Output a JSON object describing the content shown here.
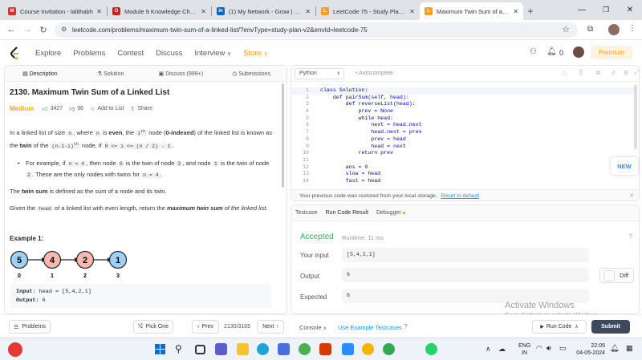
{
  "browser": {
    "tabs": [
      {
        "title": "Course Invitation - lalithabh",
        "icon_color": "#d93025",
        "icon_letter": "M"
      },
      {
        "title": "Module 9 Knowledge Check",
        "icon_color": "#c5221f",
        "icon_letter": "O"
      },
      {
        "title": "(1) My Network - Grow | Lin",
        "icon_color": "#0a66c2",
        "icon_letter": "in"
      },
      {
        "title": "LeetCode 75 - Study Plan - L",
        "icon_color": "#f89f1b",
        "icon_letter": "L"
      },
      {
        "title": "Maximum Twin Sum of a Lin",
        "icon_color": "#f89f1b",
        "icon_letter": "L"
      }
    ],
    "url": "leetcode.com/problems/maximum-twin-sum-of-a-linked-list/?envType=study-plan-v2&envId=leetcode-75"
  },
  "lc_header": {
    "nav": [
      "Explore",
      "Problems",
      "Contest",
      "Discuss",
      "Interview",
      "Store"
    ],
    "interview_suffix": "∨",
    "store_suffix": "∨",
    "notif_count": "0",
    "premium": "Premium"
  },
  "left_tabs": [
    "Description",
    "Solution",
    "Discuss (999+)",
    "Submissions"
  ],
  "problem": {
    "title": "2130. Maximum Twin Sum of a Linked List",
    "difficulty": "Medium",
    "likes": "3427",
    "dislikes": "96",
    "add_to_list": "Add to List",
    "share": "Share",
    "p1_a": "In a linked list of size",
    "p1_n": "n",
    "p1_b": ", where",
    "p1_n2": "n",
    "p1_c": "is",
    "p1_even": "even",
    "p1_d": ", the",
    "p1_ith": "i",
    "p1_th": "th",
    "p1_e": "node (",
    "p1_zero": "0-indexed",
    "p1_f": ") of the linked list is",
    "p2_a": "known as the",
    "p2_twin": "twin",
    "p2_b": "of the",
    "p2_code": "(n-1-i)",
    "p2_th": "th",
    "p2_c": "node, if",
    "p2_code2": "0 <= i <= (n / 2) - 1",
    "p2_d": ".",
    "b1_a": "For example, if",
    "b1_code": "n = 4",
    "b1_b": ", then node",
    "b1_code2": "0",
    "b1_c": "is the twin of node",
    "b1_code3": "3",
    "b1_d": ", and node",
    "b1_code4": "1",
    "b1_e": "is the",
    "b2_a": "twin of node",
    "b2_code": "2",
    "b2_b": ". These are the only nodes with twins for",
    "b2_code2": "n = 4",
    "b2_c": ".",
    "p3_a": "The",
    "p3_bold": "twin sum",
    "p3_b": "is defined as the sum of a node and its twin.",
    "p4_a": "Given the",
    "p4_code": "head",
    "p4_b": "of a linked list with even length, return the",
    "p4_bold": "maximum twin sum",
    "p4_c": "of the",
    "p4_d": "linked list.",
    "example_title": "Example 1:",
    "nodes": [
      {
        "value": "5",
        "index": "0",
        "color": "#9fd0f5"
      },
      {
        "value": "4",
        "index": "1",
        "color": "#f7b8b0"
      },
      {
        "value": "2",
        "index": "2",
        "color": "#f7b8b0"
      },
      {
        "value": "1",
        "index": "3",
        "color": "#9fd0f5"
      }
    ],
    "input_label": "Input:",
    "input_value": "head = [5,4,2,1]",
    "output_label": "Output:",
    "output_value": "6"
  },
  "editor": {
    "language": "Python",
    "autocomplete": "Autocomplete",
    "lines": [
      {
        "n": "1",
        "text": "class Solution:"
      },
      {
        "n": "2",
        "text": "    def pairSum(self, head):"
      },
      {
        "n": "3",
        "text": "        def reverseList(head):"
      },
      {
        "n": "4",
        "text": "            prev = None"
      },
      {
        "n": "5",
        "text": "            while head:"
      },
      {
        "n": "6",
        "text": "                next = head.next"
      },
      {
        "n": "7",
        "text": "                head.next = prev"
      },
      {
        "n": "8",
        "text": "                prev = head"
      },
      {
        "n": "9",
        "text": "                head = next"
      },
      {
        "n": "10",
        "text": "            return prev"
      },
      {
        "n": "11",
        "text": ""
      },
      {
        "n": "12",
        "text": "        ans = 0"
      },
      {
        "n": "13",
        "text": "        slow = head"
      },
      {
        "n": "14",
        "text": "        fast = head"
      }
    ],
    "restore_msg": "Your previous code was restored from your local storage.",
    "reset_link": "Reset to default",
    "new_badge": "NEW"
  },
  "result": {
    "tabs": [
      "Testcase",
      "Run Code Result",
      "Debugger"
    ],
    "status": "Accepted",
    "runtime": "Runtime: 11 ms",
    "your_input_label": "Your input",
    "your_input": "[5,4,2,1]",
    "output_label": "Output",
    "output": "6",
    "diff": "Diff",
    "expected_label": "Expected",
    "expected": "6"
  },
  "watermark": {
    "line1": "Activate Windows",
    "line2": "Go to Settings to activate Windows."
  },
  "footer": {
    "problems": "Problems",
    "pick_one": "Pick One",
    "prev": "Prev",
    "counter": "2130/3165",
    "next": "Next",
    "console": "Console",
    "use_example": "Use Example Testcases",
    "run_code": "Run Code",
    "submit": "Submit"
  },
  "taskbar": {
    "lang": "ENG",
    "region": "IN",
    "time": "22:05",
    "date": "04-05-2024"
  }
}
